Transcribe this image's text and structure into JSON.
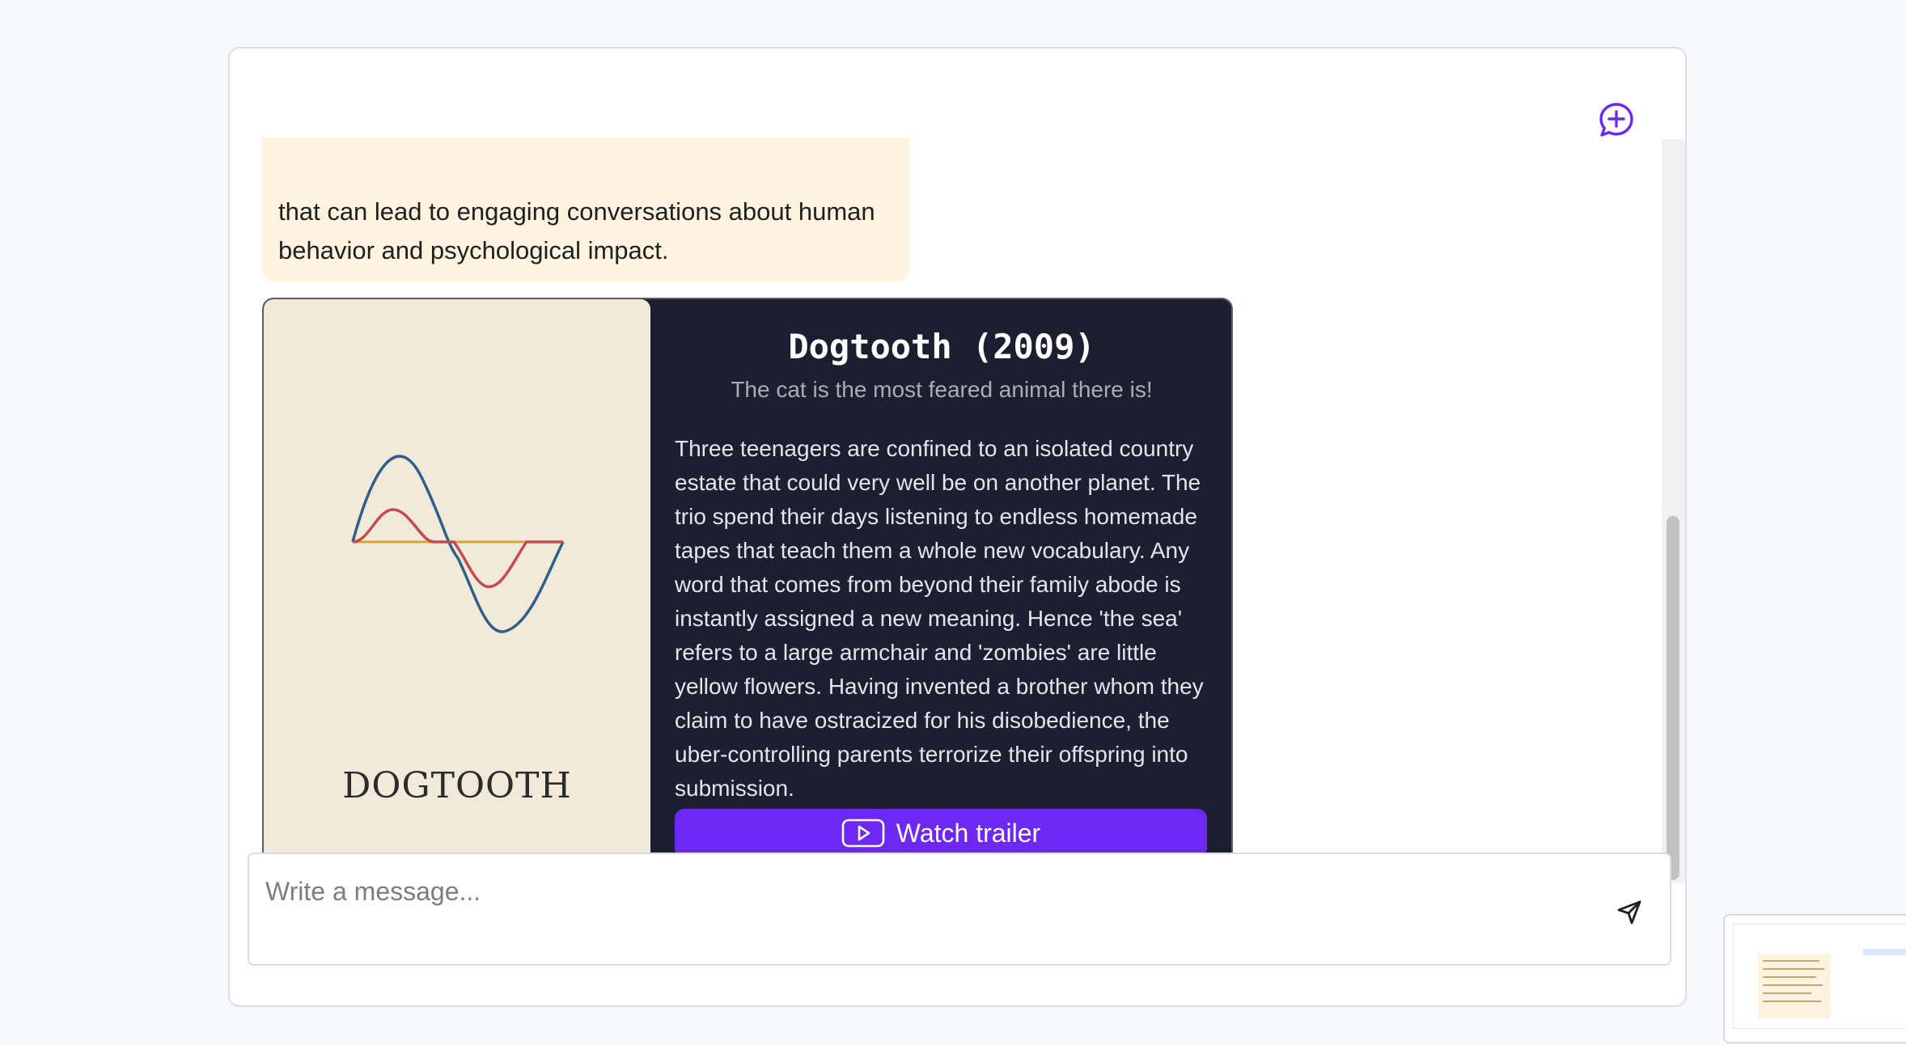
{
  "chat": {
    "bot_message_lines": [
      "that can lead to engaging conversations about human",
      "behavior and psychological impact."
    ]
  },
  "movie": {
    "poster_title": "DOGTOOTH",
    "title": "Dogtooth (2009)",
    "tagline": "The cat is the most feared animal there is!",
    "description_lines": [
      "Three teenagers are confined to an isolated country",
      "estate that could very well be on another planet. The",
      "trio spend their days listening to endless homemade",
      "tapes that teach them a whole new vocabulary. Any",
      "word that comes from beyond their family abode is",
      "instantly assigned a new meaning. Hence 'the sea'",
      "refers to a large armchair and 'zombies' are little",
      "yellow flowers. Having invented a brother whom they",
      "claim to have ostracized for his disobedience, the",
      "uber-controlling parents terrorize their offspring into",
      "submission."
    ],
    "trailer_label": "Watch trailer",
    "trailer_icon": "play-icon"
  },
  "composer": {
    "placeholder": "Write a message...",
    "send_icon": "send-icon"
  },
  "header": {
    "new_chat_icon": "new-chat-icon"
  },
  "colors": {
    "accent": "#6d28f5",
    "card_bg": "#1b2030",
    "bot_bubble": "#fdf3df",
    "poster_bg": "#f1eadb"
  }
}
